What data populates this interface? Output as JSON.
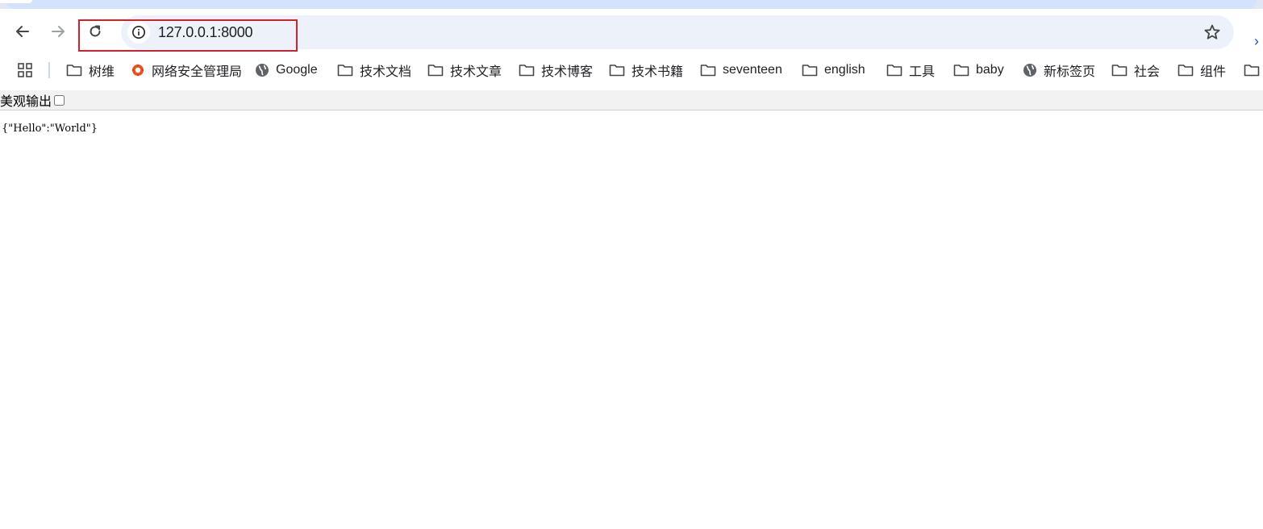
{
  "browser": {
    "address_bar": {
      "url": "127.0.0.1:8000"
    },
    "bookmarks": [
      {
        "label": "树维",
        "icon": "folder-icon"
      },
      {
        "label": "网络安全管理局",
        "icon": "site-logo-icon"
      },
      {
        "label": "Google",
        "icon": "globe-icon"
      },
      {
        "label": "技术文档",
        "icon": "folder-icon"
      },
      {
        "label": "技术文章",
        "icon": "folder-icon"
      },
      {
        "label": "技术博客",
        "icon": "folder-icon"
      },
      {
        "label": "技术书籍",
        "icon": "folder-icon"
      },
      {
        "label": "seventeen",
        "icon": "folder-icon"
      },
      {
        "label": "english",
        "icon": "folder-icon"
      },
      {
        "label": "工具",
        "icon": "folder-icon"
      },
      {
        "label": "baby",
        "icon": "folder-icon"
      },
      {
        "label": "新标签页",
        "icon": "globe-icon"
      },
      {
        "label": "社会",
        "icon": "folder-icon"
      },
      {
        "label": "组件",
        "icon": "folder-icon"
      }
    ]
  },
  "page": {
    "pretty_print_label": "美观输出",
    "pretty_print_checked": false,
    "json_text": "{\"Hello\":\"World\"}"
  },
  "colors": {
    "highlight_box": "#d32030",
    "omnibox_bg": "#edf2fa",
    "tabstrip_bg": "#d3e3fd"
  }
}
